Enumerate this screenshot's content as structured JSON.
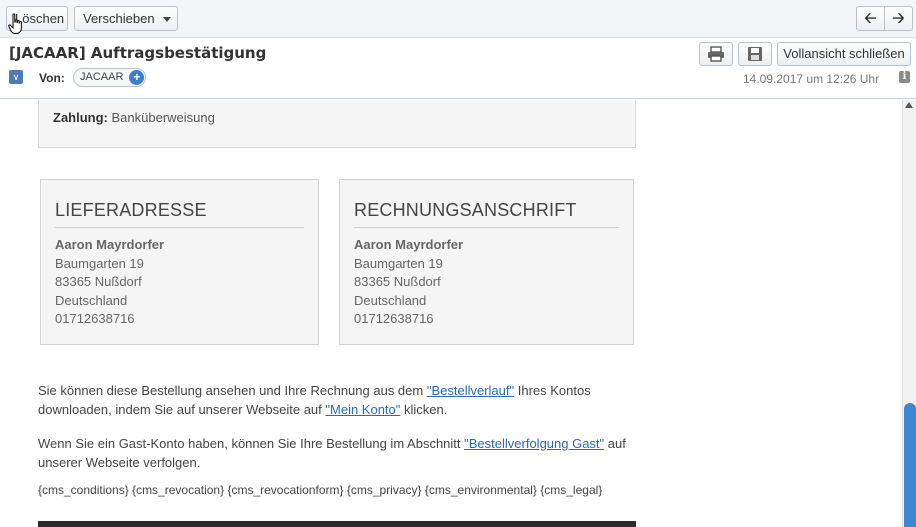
{
  "toolbar": {
    "delete_label": "Löschen",
    "move_label": "Verschieben",
    "prev_icon": "arrow-left-icon",
    "next_icon": "arrow-right-icon"
  },
  "header": {
    "subject": "[JACAAR] Auftragsbestätigung",
    "close_fullview_label": "Vollansicht schließen",
    "from_label": "Von:",
    "sender": "JACAAR",
    "date": "14.09.2017 um 12:26 Uhr"
  },
  "email": {
    "payment": {
      "label": "Zahlung:",
      "value": "Banküberweisung"
    },
    "shipping": {
      "title": "LIEFERADRESSE",
      "name": "Aaron Mayrdorfer",
      "street": "Baumgarten 19",
      "city": "83365 Nußdorf",
      "country": "Deutschland",
      "phone": "01712638716"
    },
    "billing": {
      "title": "RECHNUNGSANSCHRIFT",
      "name": "Aaron Mayrdorfer",
      "street": "Baumgarten 19",
      "city": "83365 Nußdorf",
      "country": "Deutschland",
      "phone": "01712638716"
    },
    "para1": {
      "text_a": "Sie können diese Bestellung ansehen und Ihre Rechnung aus dem ",
      "link_a": "\"Bestellverlauf\"",
      "text_b": " Ihres Kontos downloaden, indem Sie auf unserer Webseite auf ",
      "link_b": "\"Mein Konto\"",
      "text_c": " klicken."
    },
    "para2": {
      "text_a": "Wenn Sie ein Gast-Konto haben, können Sie Ihre Bestellung im Abschnitt ",
      "link_a": "\"Bestellverfolgung Gast\"",
      "text_b": " auf unserer Webseite verfolgen."
    },
    "cms_line": "{cms_conditions} {cms_revocation} {cms_revocationform} {cms_privacy} {cms_environmental} {cms_legal}"
  },
  "colors": {
    "link": "#2a6ab4",
    "accent": "#3b87d4"
  }
}
